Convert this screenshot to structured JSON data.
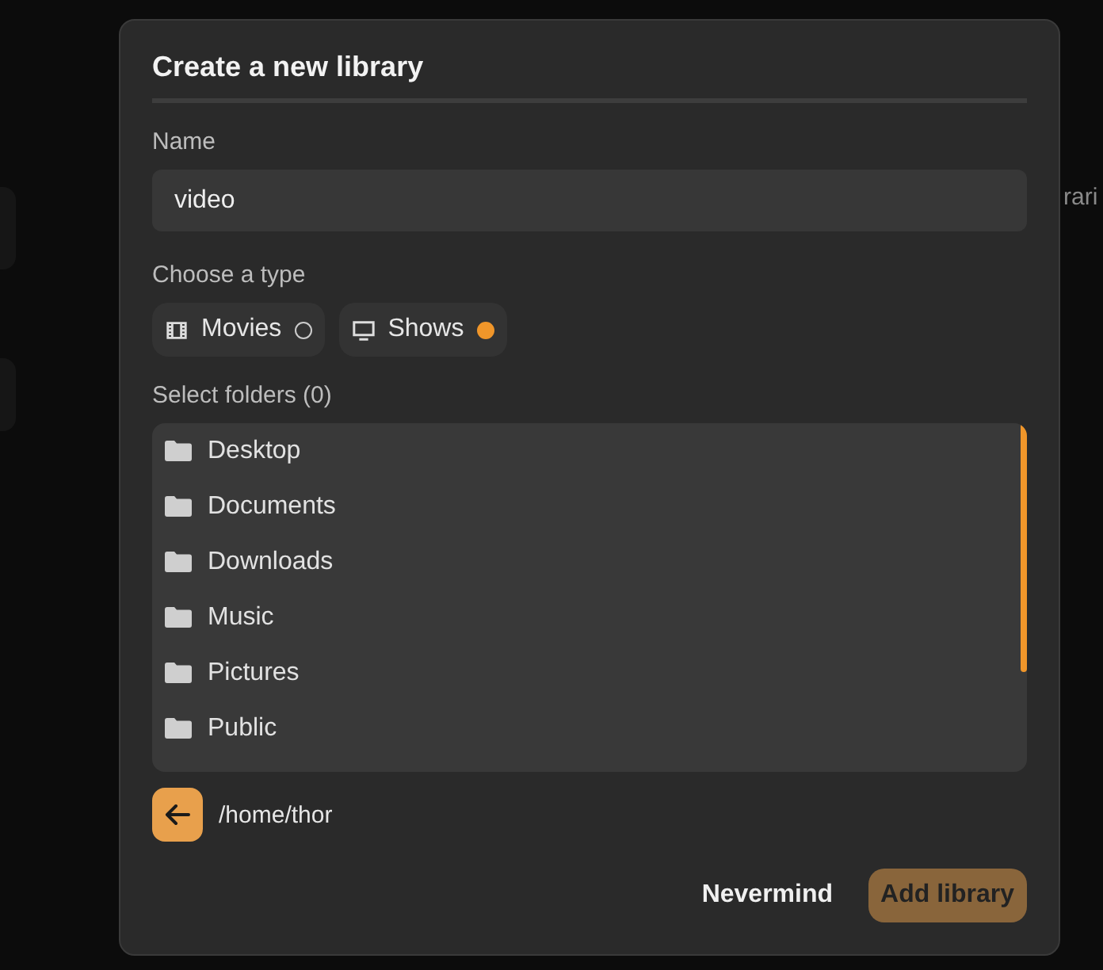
{
  "background": {
    "text": "rari"
  },
  "dialog": {
    "title": "Create a new library",
    "name_field": {
      "label": "Name",
      "value": "video"
    },
    "type_choice": {
      "label": "Choose a type",
      "options": [
        {
          "kind": "movies",
          "label": "Movies",
          "selected": false
        },
        {
          "kind": "shows",
          "label": "Shows",
          "selected": true
        }
      ]
    },
    "folders": {
      "label": "Select folders (0)",
      "items": [
        {
          "name": "Desktop"
        },
        {
          "name": "Documents"
        },
        {
          "name": "Downloads"
        },
        {
          "name": "Music"
        },
        {
          "name": "Pictures"
        },
        {
          "name": "Public"
        }
      ]
    },
    "path": "/home/thor",
    "buttons": [
      {
        "kind": "cancel",
        "label": "Nevermind",
        "disabled": false
      },
      {
        "kind": "primary",
        "label": "Add library",
        "disabled": true
      }
    ]
  }
}
